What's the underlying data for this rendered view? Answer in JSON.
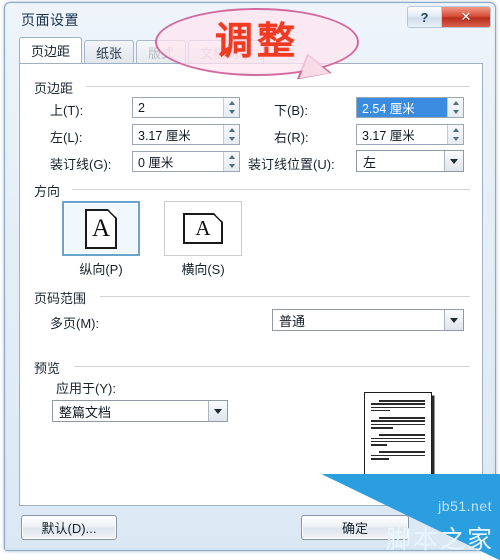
{
  "window": {
    "title": "页面设置",
    "help_button": "?",
    "close_button": "✕"
  },
  "tabs": [
    {
      "label": "页边距",
      "state": "active"
    },
    {
      "label": "纸张",
      "state": "normal"
    },
    {
      "label": "版式",
      "state": "dim"
    },
    {
      "label": "文档网格",
      "state": "dim"
    }
  ],
  "margins": {
    "group_title": "页边距",
    "top": {
      "label": "上(T):",
      "value": "2"
    },
    "bottom": {
      "label": "下(B):",
      "value": "2.54 厘米",
      "selected": true
    },
    "left": {
      "label": "左(L):",
      "value": "3.17 厘米"
    },
    "right": {
      "label": "右(R):",
      "value": "3.17 厘米"
    },
    "gutter": {
      "label": "装订线(G):",
      "value": "0 厘米"
    },
    "gutter_position": {
      "label": "装订线位置(U):",
      "value": "左"
    }
  },
  "orientation": {
    "group_title": "方向",
    "portrait": {
      "label": "纵向(P)",
      "glyph": "A",
      "selected": true
    },
    "landscape": {
      "label": "横向(S)",
      "glyph": "A",
      "selected": false
    }
  },
  "pages": {
    "group_title": "页码范围",
    "multiple_pages": {
      "label": "多页(M):",
      "value": "普通"
    }
  },
  "preview": {
    "group_title": "预览",
    "apply_to": {
      "label": "应用于(Y):",
      "value": "整篇文档"
    }
  },
  "buttons": {
    "default": "默认(D)...",
    "ok": "确定"
  },
  "annotation": {
    "text": "调整",
    "color": "#f03b22",
    "bubble_border": "#d26a9e"
  },
  "watermark": {
    "english": "jb51.net",
    "chinese": "脚本之家",
    "color": "#2a9ede"
  }
}
